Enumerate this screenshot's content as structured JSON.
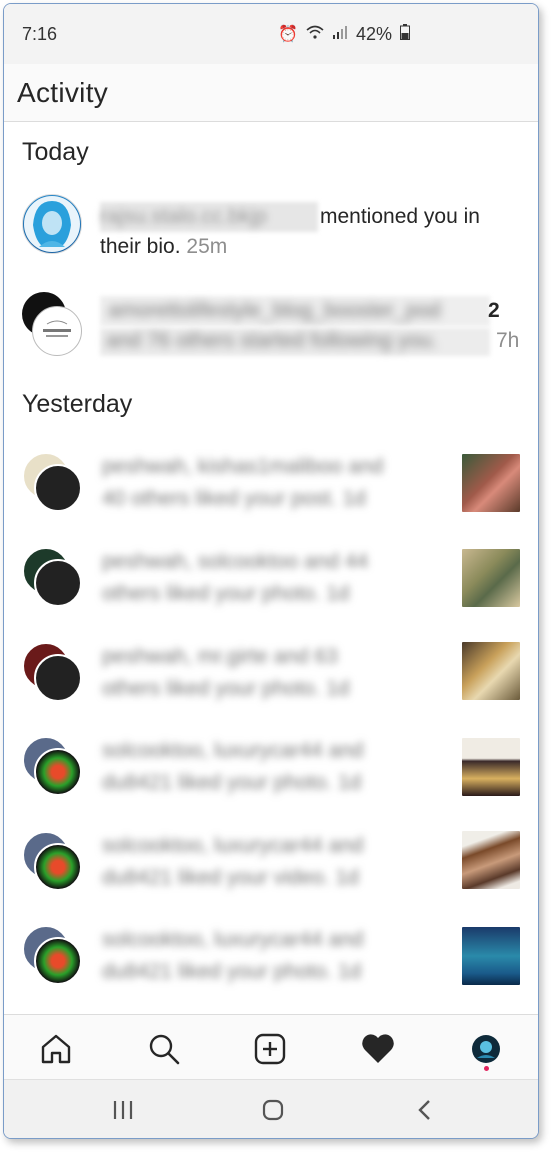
{
  "status_bar": {
    "time": "7:16",
    "battery": "42%"
  },
  "header": {
    "title": "Activity"
  },
  "sections": {
    "today": "Today",
    "yesterday": "Yesterday"
  },
  "today_items": [
    {
      "username_blurred": "rajsu.stalo.cc.bkjp",
      "text_suffix": "mentioned you in",
      "line2": "their bio.",
      "time": "25m"
    },
    {
      "username_blurred": "amorettolifestyle_blog_booster_pod",
      "badge": "2",
      "line2_blurred": "and 76 others started following you.",
      "time": "7h"
    }
  ],
  "yesterday_items": [
    {
      "line1_blurred": "peshwah, kishas1maliboo and",
      "line2_blurred": "40 others liked your post. 1d",
      "thumb_color": "#7a4a3a"
    },
    {
      "line1_blurred": "peshwah, solcooktoo and 44",
      "line2_blurred": "others liked your photo. 1d",
      "thumb_color": "#8a8a5a"
    },
    {
      "line1_blurred": "peshwah, mr.girte and 63",
      "line2_blurred": "others liked your photo. 1d",
      "thumb_color": "#a07a3a"
    },
    {
      "line1_blurred": "solcooktoo, luxurycar44 and",
      "line2_blurred": "du8421 liked your photo. 1d",
      "thumb_color": "#3a2a2a"
    },
    {
      "line1_blurred": "solcooktoo, luxurycar44 and",
      "line2_blurred": "du8421 liked your video. 1d",
      "thumb_color": "#8a5a3a"
    },
    {
      "line1_blurred": "solcooktoo, luxurycar44 and",
      "line2_blurred": "du8421 liked your photo. 1d",
      "thumb_color": "#2a6a7a"
    }
  ],
  "nav": {
    "items": [
      "home-icon",
      "search-icon",
      "add-icon",
      "heart-icon",
      "profile-avatar"
    ]
  },
  "colors": {
    "accent_dot": "#e0245e",
    "text": "#262626",
    "muted": "#8e8e8e"
  }
}
